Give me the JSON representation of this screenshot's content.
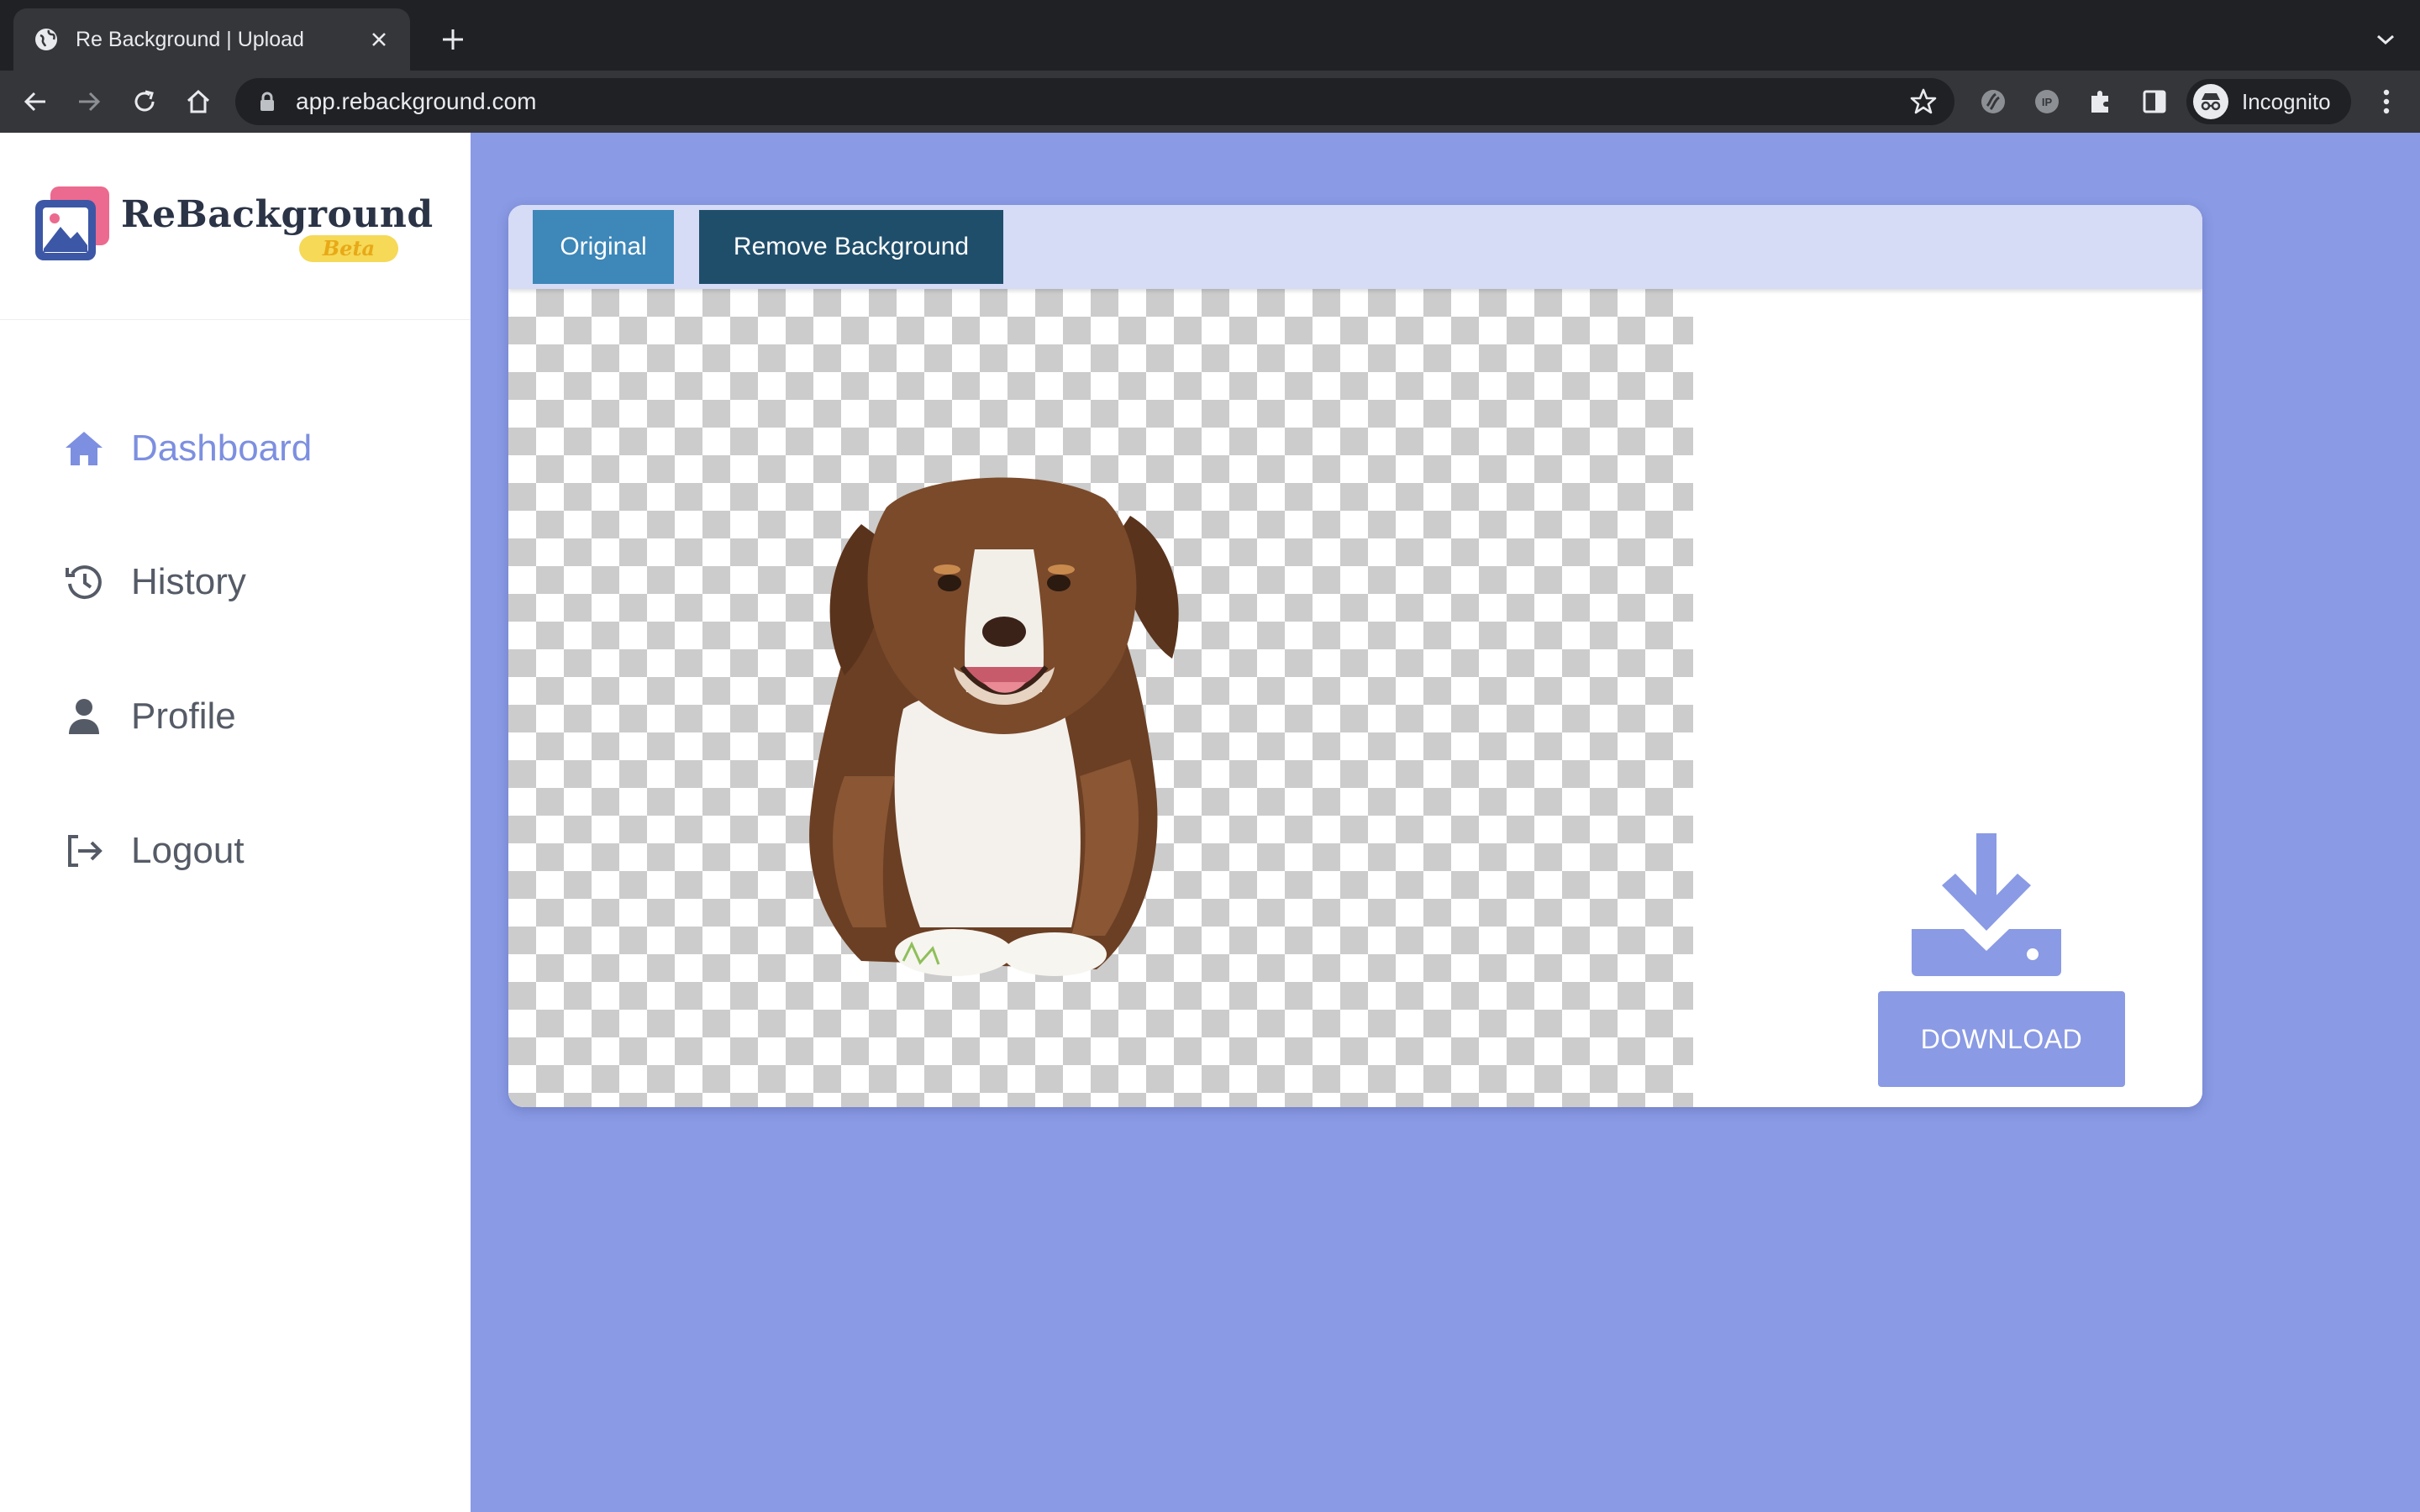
{
  "browser": {
    "tab_title": "Re Background | Upload",
    "url": "app.rebackground.com",
    "profile_label": "Incognito"
  },
  "sidebar": {
    "logo": {
      "name": "ReBackground",
      "badge": "Beta"
    },
    "items": [
      {
        "label": "Dashboard",
        "icon": "home-icon",
        "active": true
      },
      {
        "label": "History",
        "icon": "history-icon",
        "active": false
      },
      {
        "label": "Profile",
        "icon": "person-icon",
        "active": false
      },
      {
        "label": "Logout",
        "icon": "logout-icon",
        "active": false
      }
    ]
  },
  "editor": {
    "tabs": [
      {
        "label": "Original"
      },
      {
        "label": "Remove Background"
      }
    ],
    "download_label": "DOWNLOAD"
  },
  "colors": {
    "accent": "#8a9ae4",
    "tab_original": "#3d87b9",
    "tab_remove": "#1f4e6b",
    "tab_bar": "#d6dbf6"
  }
}
